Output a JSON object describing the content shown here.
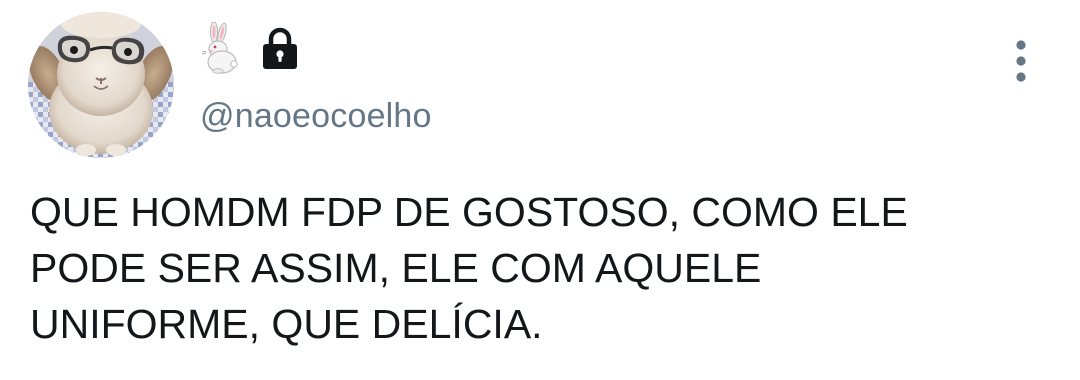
{
  "tweet": {
    "handle": "@naoeocoelho",
    "text": "QUE HOMDM FDP DE GOSTOSO, COMO ELE\nPODE SER ASSIM, ELE COM AQUELE\nUNIFORME, QUE DELÍCIA.",
    "display_name_icons": [
      "rabbit-icon",
      "lock-icon"
    ],
    "avatar": "bunny-with-glasses-avatar"
  },
  "colors": {
    "text": "#14171a",
    "handle": "#657786",
    "menu_dots": "#657786",
    "lock": "#14171a"
  }
}
